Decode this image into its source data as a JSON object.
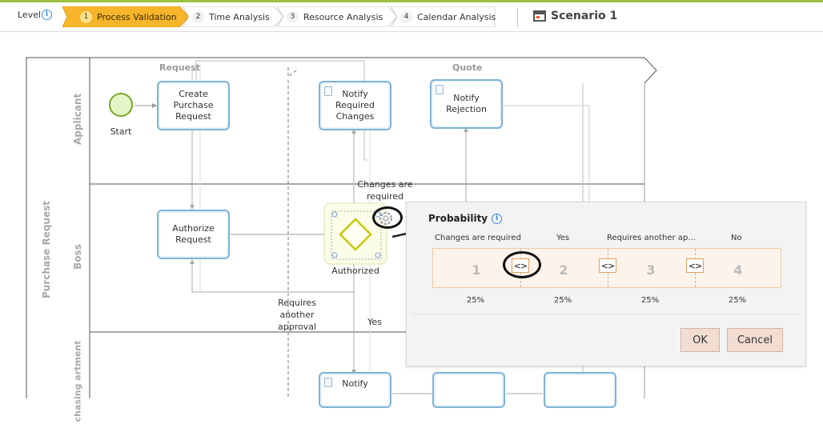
{
  "toolbar": {
    "level_label": "Level",
    "steps": [
      {
        "num": "1",
        "label": "Process Validation",
        "active": true
      },
      {
        "num": "2",
        "label": "Time Analysis",
        "active": false
      },
      {
        "num": "3",
        "label": "Resource Analysis",
        "active": false
      },
      {
        "num": "4",
        "label": "Calendar Analysis",
        "active": false
      }
    ],
    "scenario": "Scenario 1"
  },
  "diagram": {
    "pool": "Purchase Request",
    "lanes": [
      "Applicant",
      "Boss",
      "chasing artment"
    ],
    "group_labels": {
      "request": "Request",
      "quote": "Quote"
    },
    "start_label": "Start",
    "tasks": {
      "create": "Create Purchase Request",
      "notify_changes": "Notify Required Changes",
      "notify_rejection": "Notify Rejection",
      "authorize": "Authorize Request",
      "notify_bottom": "Notify"
    },
    "gateway_label": "Authorized",
    "flow_labels": {
      "changes": "Changes are required",
      "another": "Requires another approval",
      "yes": "Yes"
    }
  },
  "popup": {
    "title": "Probability",
    "paths": [
      {
        "label": "Changes are required",
        "segment": "1",
        "percent": "25%"
      },
      {
        "label": "Yes",
        "segment": "2",
        "percent": "25%"
      },
      {
        "label": "Requires another ap...",
        "segment": "3",
        "percent": "25%"
      },
      {
        "label": "No",
        "segment": "4",
        "percent": "25%"
      }
    ],
    "handle_glyph": "<>",
    "ok_label": "OK",
    "cancel_label": "Cancel"
  },
  "colors": {
    "active_step": "#f7b52c",
    "accent_line": "#9dc23d",
    "task_border": "#7fb3d6",
    "gateway": "#c4c900",
    "start_event": "#79a82b"
  },
  "icons": [
    "info-icon",
    "scenario-icon",
    "gear-icon",
    "document-icon"
  ]
}
